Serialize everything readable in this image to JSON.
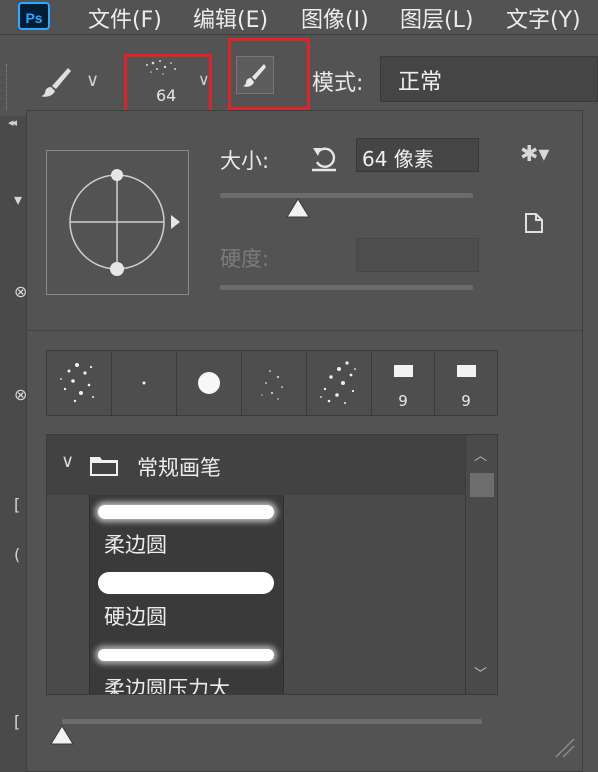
{
  "menubar": {
    "app_logo": "Ps",
    "items": [
      "文件(F)",
      "编辑(E)",
      "图像(I)",
      "图层(L)",
      "文字(Y)"
    ]
  },
  "options_bar": {
    "brush_size": "64",
    "mode_label": "模式:",
    "mode_value": "正常"
  },
  "brush_panel": {
    "size_label": "大小:",
    "size_value": "64 像素",
    "size_slider_fraction": 0.31,
    "hardness_label": "硬度:",
    "hardness_value": "",
    "recent_brushes": [
      {
        "kind": "spatter",
        "number": ""
      },
      {
        "kind": "dot",
        "number": ""
      },
      {
        "kind": "round",
        "number": ""
      },
      {
        "kind": "spatter-light",
        "number": ""
      },
      {
        "kind": "spatter",
        "number": ""
      },
      {
        "kind": "square",
        "number": "9"
      },
      {
        "kind": "square",
        "number": "9"
      }
    ],
    "folder_label": "常规画笔",
    "presets": [
      {
        "label": "柔边圆",
        "stroke": "soft"
      },
      {
        "label": "硬边圆",
        "stroke": "hard"
      },
      {
        "label": "柔边圆压力大",
        "stroke": "soft"
      }
    ],
    "preview_slider_fraction": 0.0
  },
  "colors": {
    "highlight_box": "#d9262b",
    "panel_bg": "#535353",
    "field_bg": "#454545"
  },
  "icons": [
    "brush-icon",
    "chevron-down-icon",
    "toggle-brush-settings-icon",
    "reset-icon",
    "gear-icon",
    "new-preset-icon",
    "folder-icon",
    "resize-grip-icon"
  ]
}
